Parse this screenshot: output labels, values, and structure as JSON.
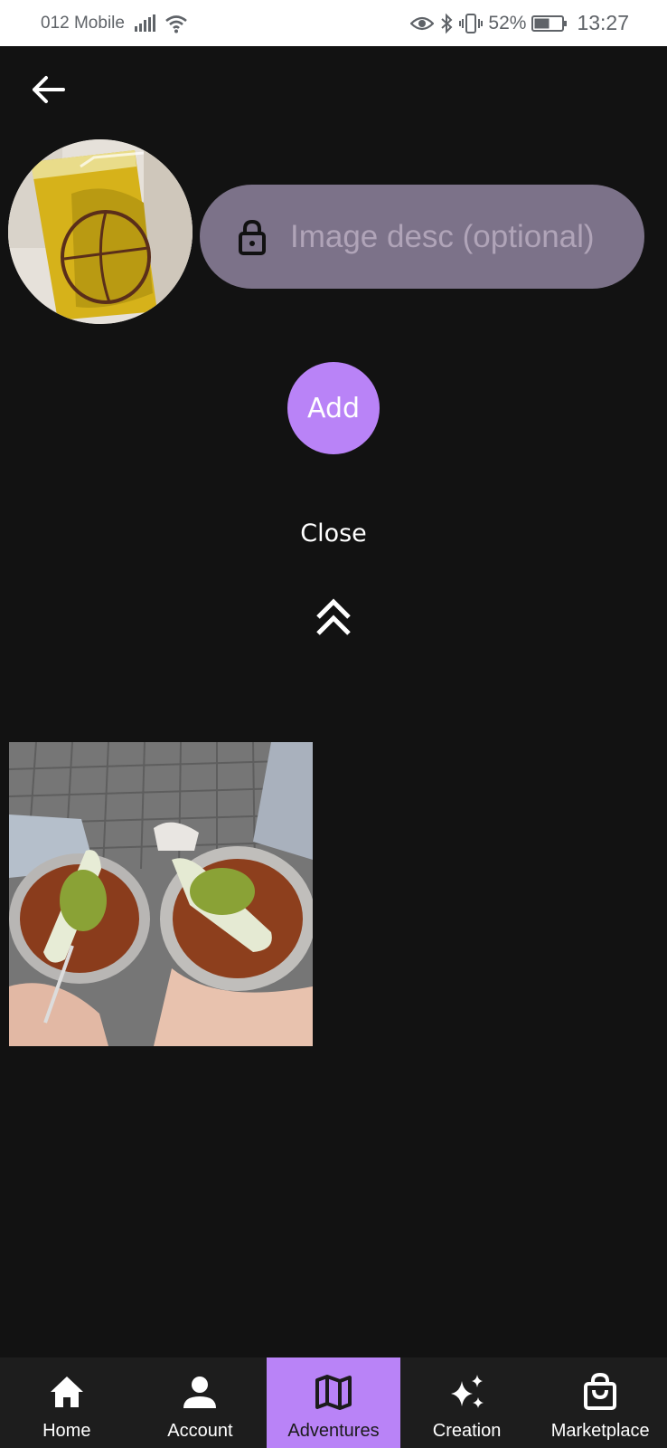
{
  "status_bar": {
    "carrier": "012 Mobile",
    "battery_percent": "52%",
    "time": "13:27",
    "icons": [
      "signal-icon",
      "wifi-icon",
      "eye-icon",
      "bluetooth-icon",
      "vibrate-icon",
      "battery-icon"
    ]
  },
  "header": {
    "back_icon": "arrow-left-icon"
  },
  "form": {
    "image_alt": "Selected image preview",
    "description_placeholder": "Image desc (optional)",
    "description_value": "",
    "lock_icon": "lock-icon",
    "add_label": "Add",
    "close_label": "Close",
    "collapse_icon": "chevrons-up-icon"
  },
  "gallery": {
    "photo_alt": "Gallery photo"
  },
  "bottom_nav": {
    "items": [
      {
        "label": "Home",
        "icon": "home-icon",
        "active": false
      },
      {
        "label": "Account",
        "icon": "person-icon",
        "active": false
      },
      {
        "label": "Adventures",
        "icon": "map-icon",
        "active": true
      },
      {
        "label": "Creation",
        "icon": "sparkles-icon",
        "active": false
      },
      {
        "label": "Marketplace",
        "icon": "shopping-bag-icon",
        "active": false
      }
    ]
  },
  "colors": {
    "background": "#121212",
    "accent": "#b983f7",
    "input_background": "#7c7289",
    "nav_background": "#1d1d1d"
  }
}
